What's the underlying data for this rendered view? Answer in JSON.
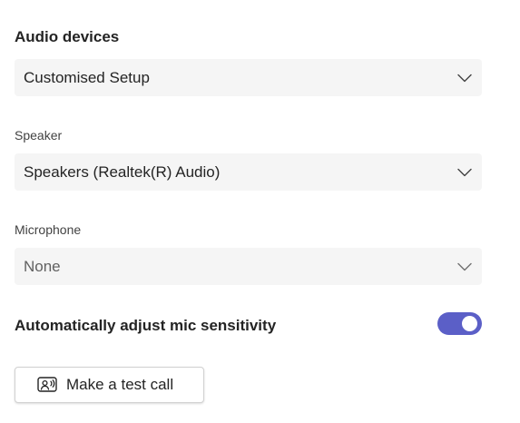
{
  "audio_devices": {
    "title": "Audio devices",
    "setup_select": {
      "value": "Customised Setup"
    }
  },
  "speaker": {
    "label": "Speaker",
    "select": {
      "value": "Speakers (Realtek(R) Audio)"
    }
  },
  "microphone": {
    "label": "Microphone",
    "select": {
      "value": "None"
    }
  },
  "mic_sensitivity": {
    "label": "Automatically adjust mic sensitivity",
    "enabled": true
  },
  "test_call": {
    "label": "Make a test call",
    "icon": "test-call-icon"
  },
  "colors": {
    "accent": "#5b5fc7",
    "select_bg": "#f5f5f5",
    "text": "#242424"
  }
}
